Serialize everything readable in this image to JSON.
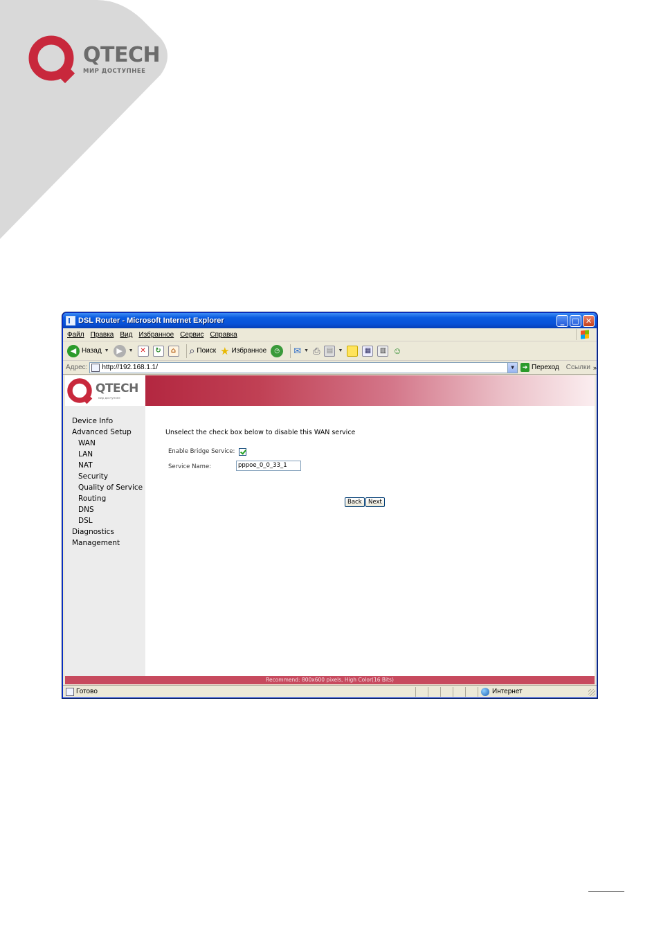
{
  "document": {
    "brand": "QTECH",
    "slogan": "МИР ДОСТУПНЕЕ"
  },
  "window": {
    "title": "DSL Router - Microsoft Internet Explorer",
    "controls": {
      "minimize": "_",
      "maximize": "□",
      "close": "✕"
    }
  },
  "menubar": {
    "items": [
      "Файл",
      "Правка",
      "Вид",
      "Избранное",
      "Сервис",
      "Справка"
    ]
  },
  "toolbar": {
    "back_label": "Назад",
    "search_label": "Поиск",
    "favorites_label": "Избранное"
  },
  "addressbar": {
    "label": "Адрес:",
    "url": "http://192.168.1.1/",
    "go_label": "Переход",
    "links_label": "Ссылки"
  },
  "router_page": {
    "banner": {
      "brand": "QTECH",
      "slogan": "мир доступнее"
    },
    "nav": [
      {
        "label": "Device Info",
        "level": 1
      },
      {
        "label": "Advanced Setup",
        "level": 1
      },
      {
        "label": "WAN",
        "level": 2
      },
      {
        "label": "LAN",
        "level": 2
      },
      {
        "label": "NAT",
        "level": 2
      },
      {
        "label": "Security",
        "level": 2
      },
      {
        "label": "Quality of Service",
        "level": 2
      },
      {
        "label": "Routing",
        "level": 2
      },
      {
        "label": "DNS",
        "level": 2
      },
      {
        "label": "DSL",
        "level": 2
      },
      {
        "label": "Diagnostics",
        "level": 1
      },
      {
        "label": "Management",
        "level": 1
      }
    ],
    "headline": "Unselect the check box below to disable this WAN service",
    "enable_bridge_label": "Enable Bridge Service:",
    "enable_bridge_checked": true,
    "service_name_label": "Service Name:",
    "service_name_value": "pppoe_0_0_33_1",
    "back_button": "Back",
    "next_button": "Next",
    "recommend_text": "Recommend: 800x600 pixels, High Color(16 Bits)"
  },
  "statusbar": {
    "status": "Готово",
    "zone": "Интернет"
  },
  "colors": {
    "brand_red": "#c8283c",
    "banner_red": "#b32740",
    "xp_blue": "#0a5be0"
  }
}
